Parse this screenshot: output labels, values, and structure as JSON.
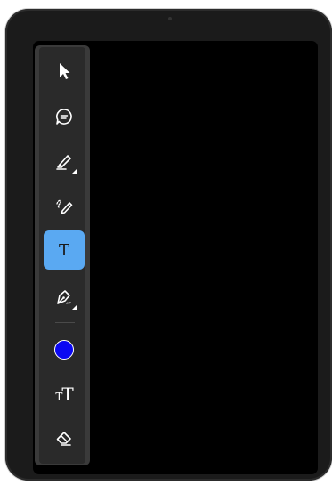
{
  "toolbar": {
    "tools": [
      {
        "id": "select",
        "icon": "pointer-arrow-icon",
        "active": false
      },
      {
        "id": "comment",
        "icon": "comment-bubble-icon",
        "active": false
      },
      {
        "id": "highlighter",
        "icon": "highlighter-icon",
        "active": false,
        "has_submenu": true
      },
      {
        "id": "freehand",
        "icon": "freehand-pen-icon",
        "active": false
      },
      {
        "id": "text",
        "icon": "text-icon",
        "active": true,
        "glyph": "T"
      },
      {
        "id": "signature",
        "icon": "signature-pen-icon",
        "active": false,
        "has_submenu": true
      },
      {
        "id": "color",
        "icon": "color-swatch",
        "active": false
      },
      {
        "id": "text-size",
        "icon": "text-size-icon",
        "active": false,
        "glyph_small": "T",
        "glyph_big": "T"
      },
      {
        "id": "eraser",
        "icon": "eraser-icon",
        "active": false
      }
    ],
    "current_color": "#0b08f2",
    "active_color": "#5aa9f2"
  }
}
